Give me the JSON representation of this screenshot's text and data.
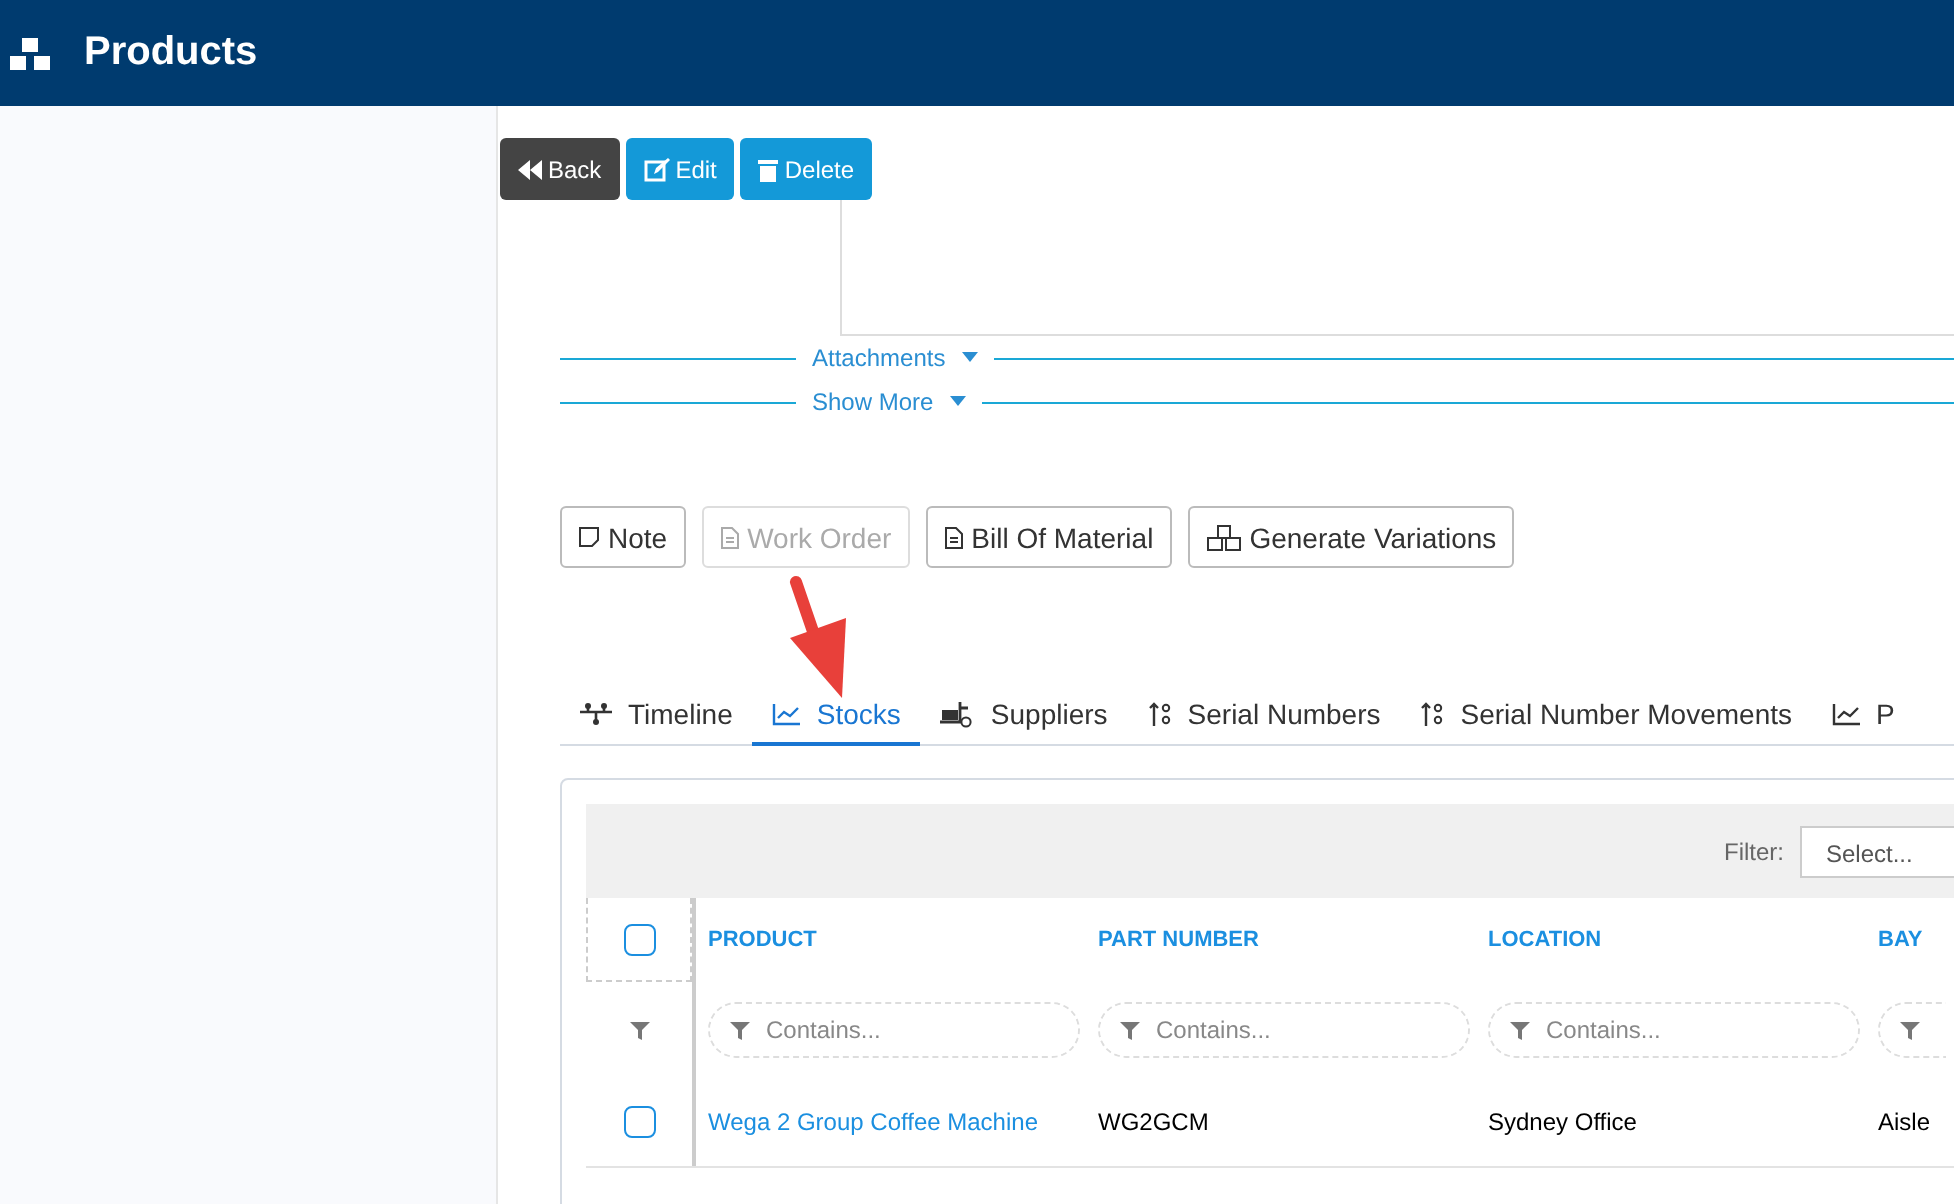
{
  "header": {
    "title": "Products"
  },
  "actions": [
    {
      "label": "Back",
      "kind": "back"
    },
    {
      "label": "Edit",
      "kind": "edit"
    },
    {
      "label": "Delete",
      "kind": "delete"
    }
  ],
  "toggles": [
    {
      "label": "Attachments",
      "expanded": false
    },
    {
      "label": "Show More",
      "expanded": false
    }
  ],
  "related_buttons": [
    {
      "label": "Note",
      "kind": "note",
      "disabled": false
    },
    {
      "label": "Work Order",
      "kind": "doc",
      "disabled": true
    },
    {
      "label": "Bill Of Material",
      "kind": "doc",
      "disabled": false
    },
    {
      "label": "Generate Variations",
      "kind": "boxes",
      "disabled": false
    }
  ],
  "tabs": [
    {
      "label": "Timeline",
      "kind": "timeline",
      "selected": false
    },
    {
      "label": "Stocks",
      "kind": "chart",
      "selected": true
    },
    {
      "label": "Suppliers",
      "kind": "truck",
      "selected": false
    },
    {
      "label": "Serial Numbers",
      "kind": "sort",
      "selected": false
    },
    {
      "label": "Serial Number Movements",
      "kind": "sort",
      "selected": false
    },
    {
      "label": "P",
      "kind": "chart",
      "selected": false
    }
  ],
  "grid": {
    "filter_label": "Filter:",
    "filter_placeholder": "Select...",
    "columns": [
      "PRODUCT",
      "PART NUMBER",
      "LOCATION",
      "BAY"
    ],
    "column_filters": [
      {
        "placeholder": "Contains..."
      },
      {
        "placeholder": "Contains..."
      },
      {
        "placeholder": "Contains..."
      },
      {
        "cut": true
      }
    ],
    "select_all_checked": false,
    "rows": [
      {
        "checked": false,
        "cells": [
          "Wega 2 Group Coffee Machine",
          "WG2GCM",
          "Sydney Office",
          "Aisle"
        ]
      }
    ]
  },
  "callout": {
    "kind": "arrow"
  }
}
